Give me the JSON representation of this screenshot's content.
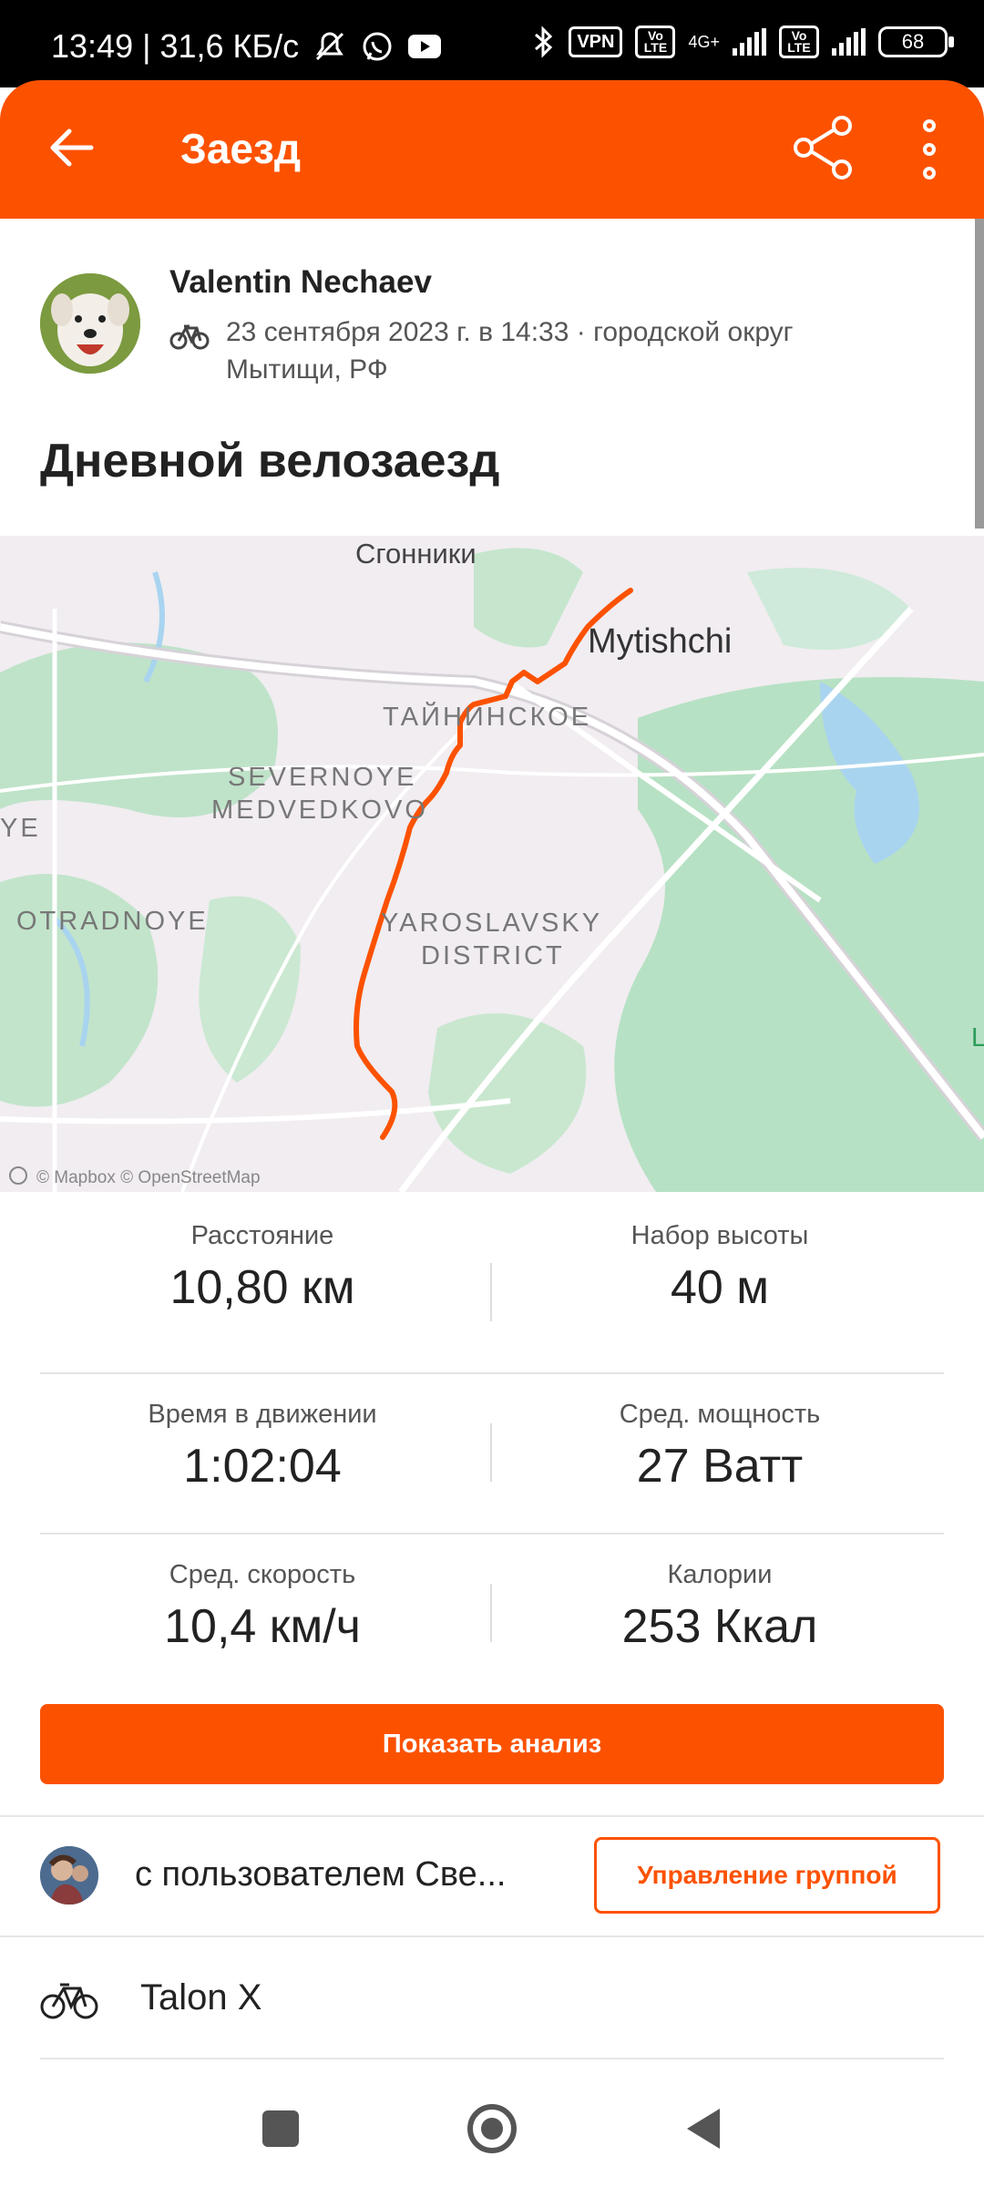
{
  "status_bar": {
    "time_speed": "13:49 | 31,6 КБ/с",
    "vpn": "VPN",
    "volte": "Vo LTE",
    "network": "4G+",
    "battery": "68"
  },
  "app_bar": {
    "title": "Заезд",
    "back_icon": "arrow-left-icon",
    "share_icon": "share-icon",
    "more_icon": "more-vertical-icon"
  },
  "activity": {
    "athlete_name": "Valentin Nechaev",
    "sport_icon": "bicycle-icon",
    "datetime_location": "23 сентября 2023 г. в 14:33 · городской округ Мытищи, РФ",
    "title": "Дневной велозаезд"
  },
  "map": {
    "labels": {
      "sgonniki": "Сгонники",
      "mytishchi": "Mytishchi",
      "tainin": "ТАЙНИНСКОЕ",
      "sev_line1": "SEVERNOYE",
      "sev_line2": "MEDVEDKOVO",
      "otradnoye": "OTRADNOYE",
      "yar_line1": "YAROSLAVSKY",
      "yar_line2": "DISTRICT",
      "edge_left": "YE",
      "edge_right": "L"
    },
    "attribution": "© Mapbox © OpenStreetMap",
    "route_color": "#fc5200"
  },
  "stats": [
    {
      "label": "Расстояние",
      "value": "10,80 км"
    },
    {
      "label": "Набор высоты",
      "value": "40 м"
    },
    {
      "label": "Время в движении",
      "value": "1:02:04"
    },
    {
      "label": "Сред. мощность",
      "value": "27 Ватт"
    },
    {
      "label": "Сред. скорость",
      "value": "10,4 км/ч"
    },
    {
      "label": "Калории",
      "value": "253 Ккал"
    }
  ],
  "analysis_button": "Показать анализ",
  "group": {
    "text": "с пользователем Све...",
    "manage_button": "Управление группой"
  },
  "gear": {
    "icon": "bicycle-icon",
    "name": "Talon X"
  },
  "nav": {
    "recents_icon": "square-icon",
    "home_icon": "circle-home-icon",
    "back_icon": "triangle-back-icon"
  },
  "colors": {
    "brand": "#fc5200",
    "map_green": "#b8e2c8",
    "map_bg": "#f2eef2"
  }
}
